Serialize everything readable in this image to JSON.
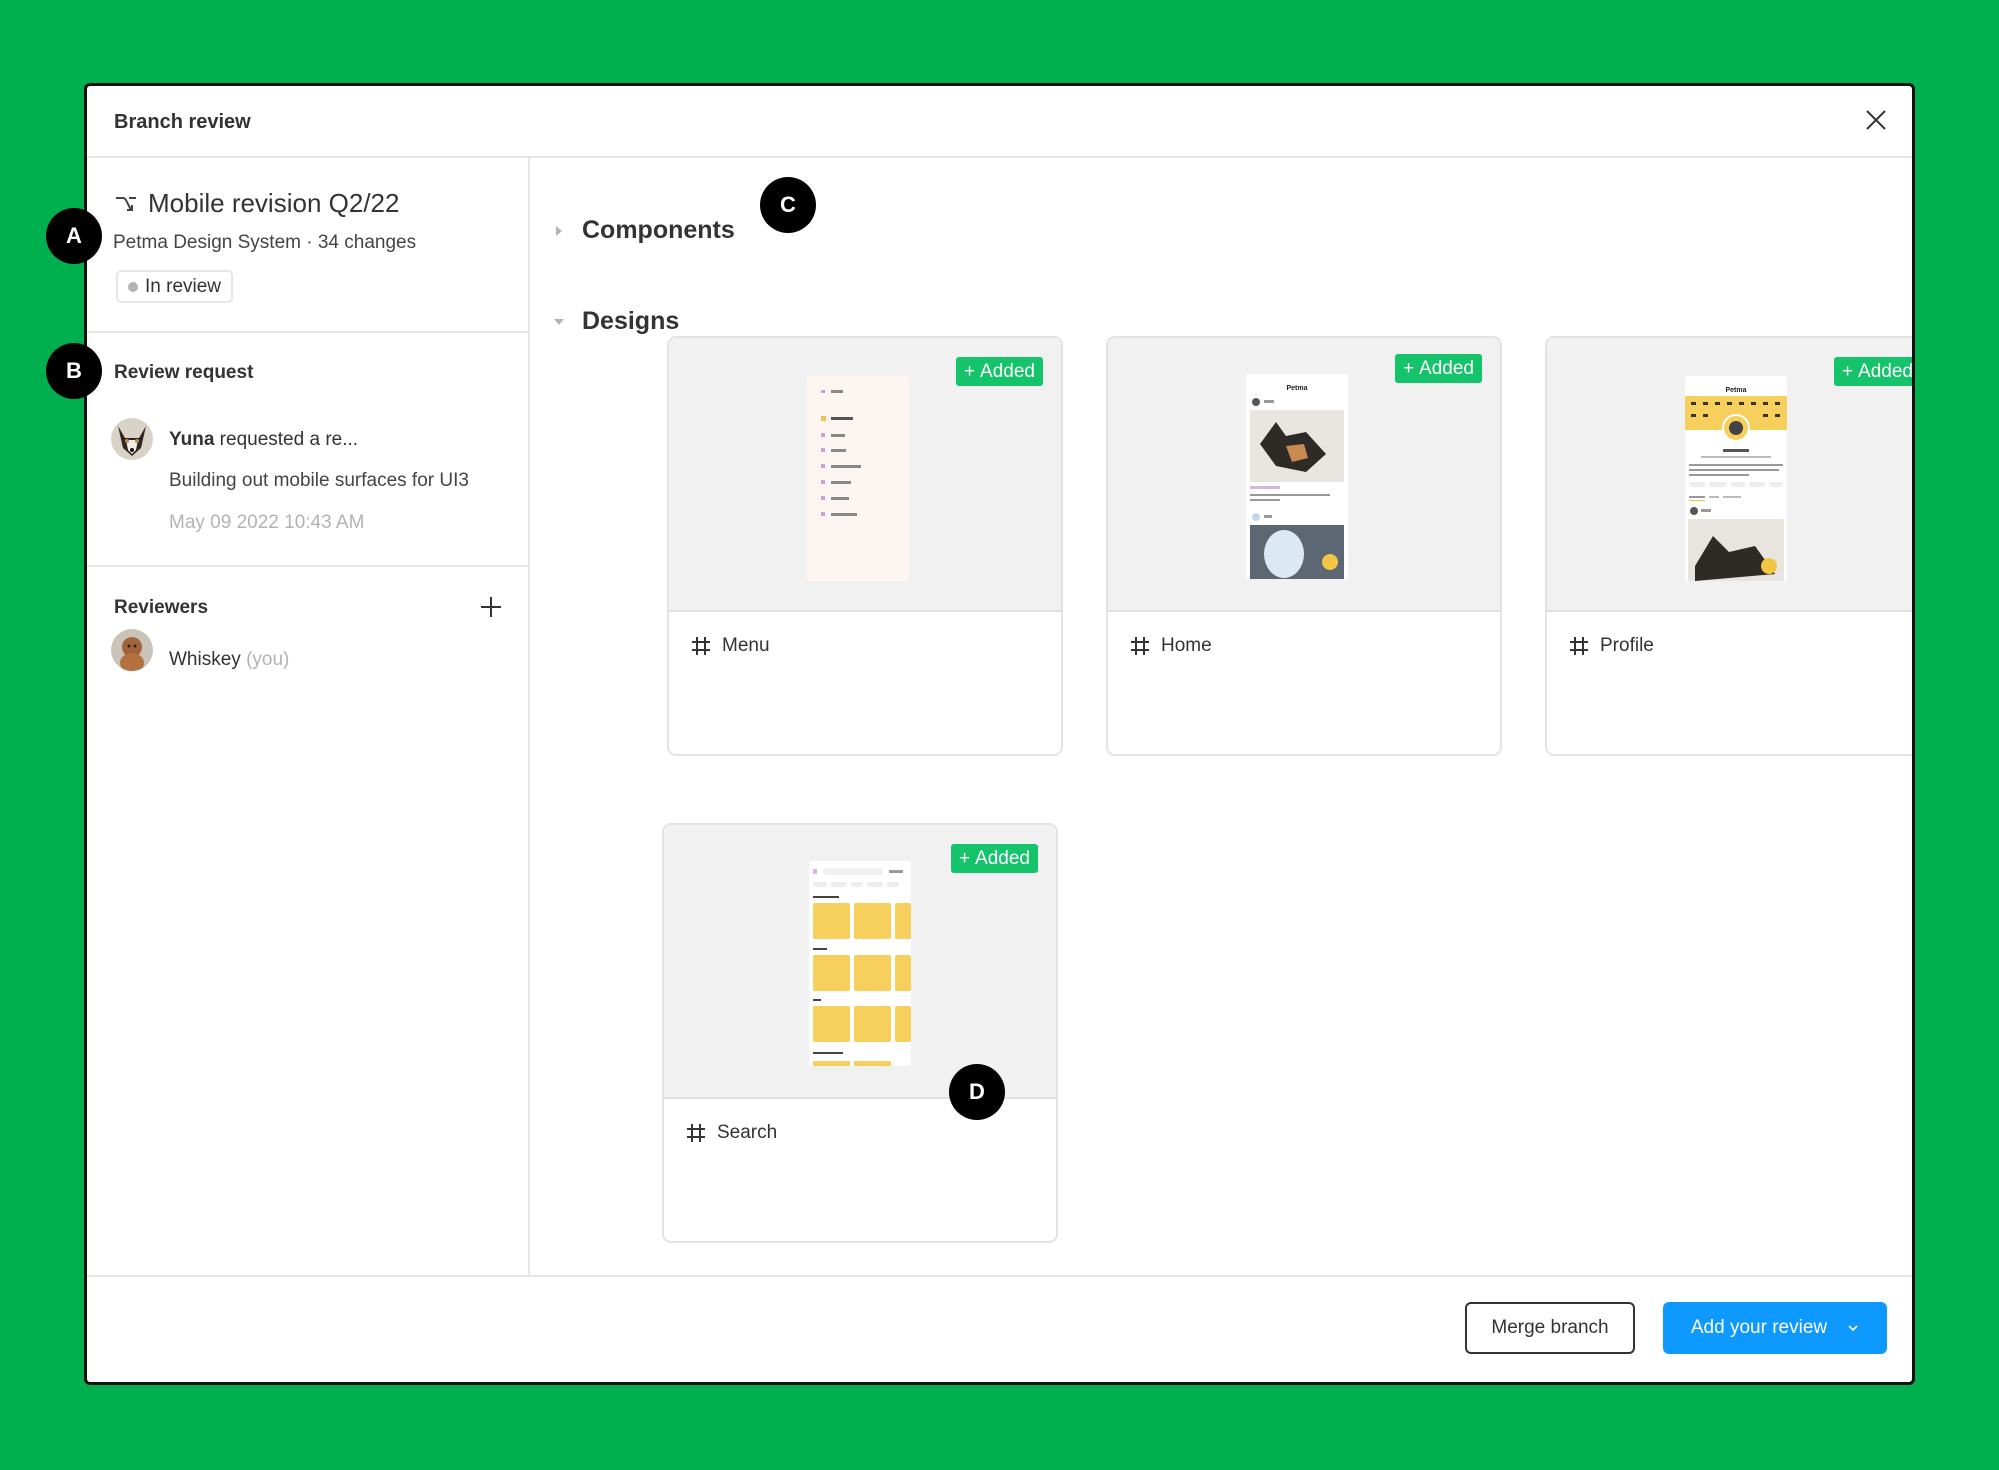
{
  "dialog": {
    "title": "Branch review",
    "close_icon": "close-icon"
  },
  "branch": {
    "icon": "branch-icon",
    "name": "Mobile revision Q2/22",
    "subtitle": "Petma Design System · 34 changes",
    "status": "In review"
  },
  "review_request": {
    "heading": "Review request",
    "requester": "Yuna",
    "action_text": " requested a re...",
    "description": "Building out mobile surfaces for UI3",
    "timestamp": "May 09 2022 10:43 AM"
  },
  "reviewers": {
    "heading": "Reviewers",
    "add_icon": "plus-icon",
    "items": [
      {
        "name": "Whiskey",
        "suffix": "(you)"
      }
    ]
  },
  "groups": {
    "components": {
      "title": "Components",
      "expanded": false
    },
    "designs": {
      "title": "Designs",
      "expanded": true
    }
  },
  "designs": [
    {
      "name": "Menu",
      "badge": "Added",
      "frame_icon": "hash-icon"
    },
    {
      "name": "Home",
      "badge": "Added",
      "frame_icon": "hash-icon"
    },
    {
      "name": "Profile",
      "badge": "Added",
      "frame_icon": "hash-icon"
    },
    {
      "name": "Search",
      "badge": "Added",
      "frame_icon": "hash-icon"
    }
  ],
  "thumbnails": {
    "menu_items": [
      "Back",
      "First Last",
      "Home",
      "Profile",
      "Notifications",
      "Settings",
      "Search",
      "Messaging"
    ],
    "app_name": "Petma"
  },
  "footer": {
    "merge_label": "Merge branch",
    "review_label": "Add your review"
  },
  "markers": [
    "A",
    "B",
    "C",
    "D"
  ],
  "colors": {
    "background": "#00b04f",
    "added_badge": "#14c36a",
    "primary_button": "#0d99ff"
  }
}
